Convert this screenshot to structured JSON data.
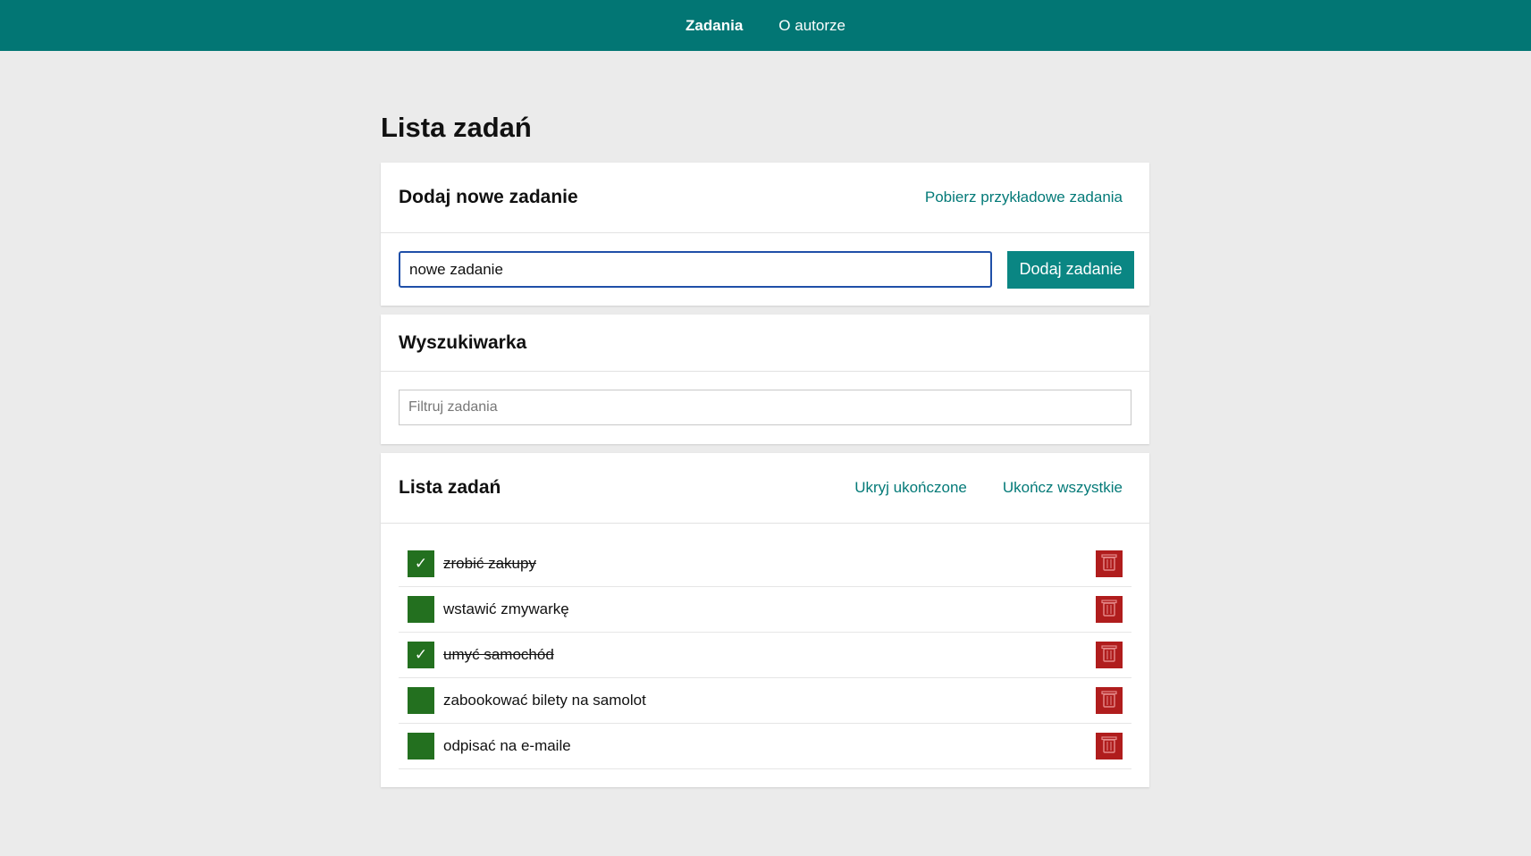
{
  "nav": {
    "tasks_label": "Zadania",
    "about_label": "O autorze"
  },
  "page": {
    "title": "Lista zadań"
  },
  "add_card": {
    "title": "Dodaj nowe zadanie",
    "fetch_examples_label": "Pobierz przykładowe zadania",
    "input_value": "nowe zadanie",
    "button_label": "Dodaj zadanie"
  },
  "search_card": {
    "title": "Wyszukiwarka",
    "placeholder": "Filtruj zadania"
  },
  "list_card": {
    "title": "Lista zadań",
    "hide_completed_label": "Ukryj ukończone",
    "complete_all_label": "Ukończ wszystkie",
    "tasks": [
      {
        "text": "zrobić zakupy",
        "done": true
      },
      {
        "text": "wstawić zmywarkę",
        "done": false
      },
      {
        "text": "umyć samochód",
        "done": true
      },
      {
        "text": "zabookować bilety na samolot",
        "done": false
      },
      {
        "text": "odpisać na e-maile",
        "done": false
      }
    ],
    "check_glyph": "✓",
    "checkbox_color": "#23701f",
    "delete_color": "#b01d1d"
  },
  "colors": {
    "nav_bg": "#027674",
    "accent": "#0a8683"
  }
}
